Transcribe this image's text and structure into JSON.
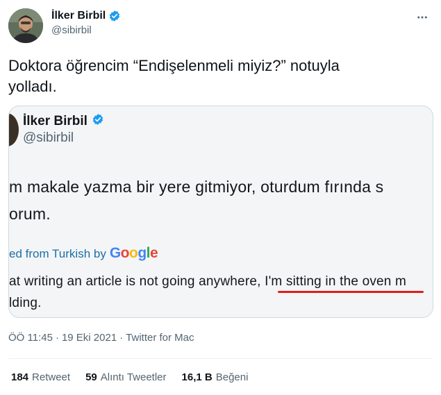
{
  "author": {
    "display_name": "İlker Birbil",
    "handle": "@sibirbil"
  },
  "tweet": {
    "text_line1": "Doktora öğrencim “Endişelenmeli miyiz?” notuyla",
    "text_line2": "yolladı."
  },
  "embedded": {
    "display_name": "İlker Birbil",
    "handle": "@sibirbil",
    "line1": "m makale yazma bir yere gitmiyor, oturdum fırında s",
    "line2": "orum.",
    "translated_prefix": "ed from Turkish by",
    "google": [
      "G",
      "o",
      "o",
      "g",
      "l",
      "e"
    ],
    "line3_pre": "at writing an article is not going anywhere, ",
    "line3_highlight": "I'm sitting in the oven m",
    "line4": "lding."
  },
  "meta": {
    "time": "ÖÖ 11:45",
    "sep1": "·",
    "date": "19 Eki 2021",
    "sep2": "·",
    "source": "Twitter for Mac"
  },
  "stats": {
    "retweets_num": "184",
    "retweets_label": "Retweet",
    "quotes_num": "59",
    "quotes_label": "Alıntı Tweetler",
    "likes_num": "16,1 B",
    "likes_label": "Beğeni"
  },
  "colors": {
    "verified": "#1d9bf0",
    "underline": "#e21b1b",
    "link": "#1d6fa5"
  },
  "icons": {
    "more": "more-dots-icon",
    "verified": "verified-badge-icon"
  }
}
